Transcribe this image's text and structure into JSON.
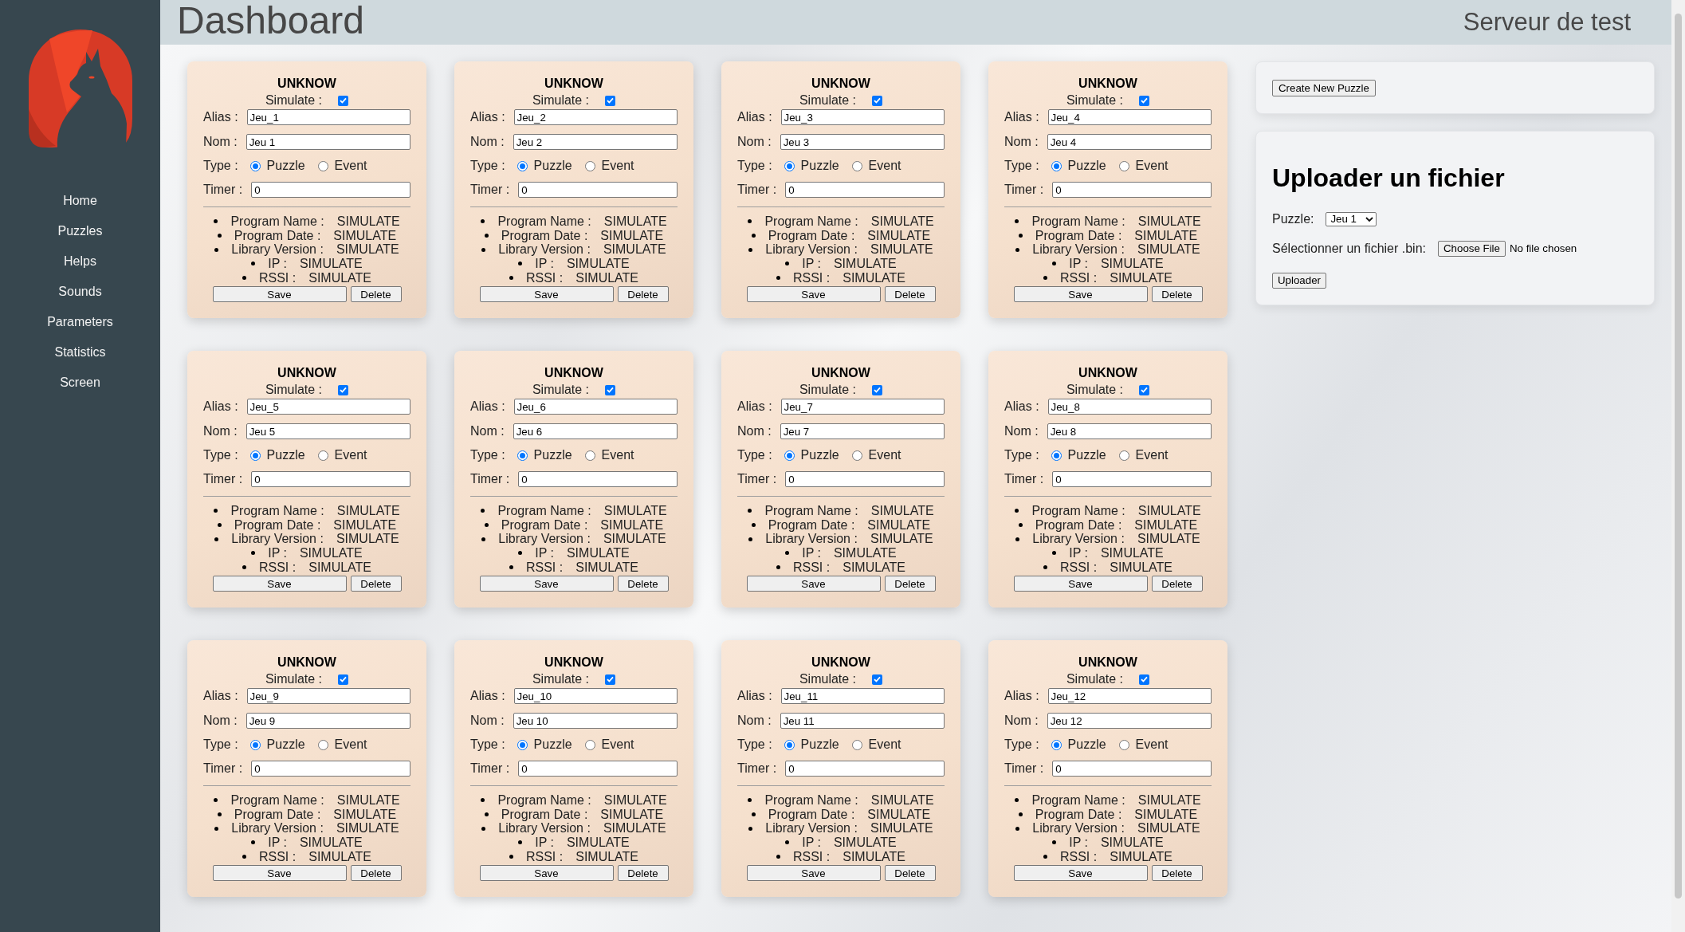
{
  "sidebar": {
    "items": [
      "Home",
      "Puzzles",
      "Helps",
      "Sounds",
      "Parameters",
      "Statistics",
      "Screen"
    ]
  },
  "header": {
    "title": "Dashboard",
    "server": "Serveur de test"
  },
  "puzzles": [
    {
      "title": "UNKNOW",
      "simulate": {
        "label": "Simulate :",
        "checked": true
      },
      "alias": {
        "label": "Alias :",
        "value": "Jeu_1"
      },
      "nom": {
        "label": "Nom :",
        "value": "Jeu 1"
      },
      "type": {
        "label": "Type :",
        "options": [
          {
            "label": "Puzzle",
            "selected": true
          },
          {
            "label": "Event",
            "selected": false
          }
        ]
      },
      "timer": {
        "label": "Timer :",
        "value": "0"
      },
      "info": [
        {
          "label": "Program Name :",
          "value": "SIMULATE"
        },
        {
          "label": "Program Date :",
          "value": "SIMULATE"
        },
        {
          "label": "Library Version :",
          "value": "SIMULATE"
        },
        {
          "label": "IP :",
          "value": "SIMULATE"
        },
        {
          "label": "RSSI :",
          "value": "SIMULATE"
        }
      ],
      "buttons": [
        {
          "kind": "save",
          "label": "Save"
        },
        {
          "kind": "delete",
          "label": "Delete"
        }
      ]
    },
    {
      "title": "UNKNOW",
      "simulate": {
        "label": "Simulate :",
        "checked": true
      },
      "alias": {
        "label": "Alias :",
        "value": "Jeu_2"
      },
      "nom": {
        "label": "Nom :",
        "value": "Jeu 2"
      },
      "type": {
        "label": "Type :",
        "options": [
          {
            "label": "Puzzle",
            "selected": true
          },
          {
            "label": "Event",
            "selected": false
          }
        ]
      },
      "timer": {
        "label": "Timer :",
        "value": "0"
      },
      "info": [
        {
          "label": "Program Name :",
          "value": "SIMULATE"
        },
        {
          "label": "Program Date :",
          "value": "SIMULATE"
        },
        {
          "label": "Library Version :",
          "value": "SIMULATE"
        },
        {
          "label": "IP :",
          "value": "SIMULATE"
        },
        {
          "label": "RSSI :",
          "value": "SIMULATE"
        }
      ],
      "buttons": [
        {
          "kind": "save",
          "label": "Save"
        },
        {
          "kind": "delete",
          "label": "Delete"
        }
      ]
    },
    {
      "title": "UNKNOW",
      "simulate": {
        "label": "Simulate :",
        "checked": true
      },
      "alias": {
        "label": "Alias :",
        "value": "Jeu_3"
      },
      "nom": {
        "label": "Nom :",
        "value": "Jeu 3"
      },
      "type": {
        "label": "Type :",
        "options": [
          {
            "label": "Puzzle",
            "selected": true
          },
          {
            "label": "Event",
            "selected": false
          }
        ]
      },
      "timer": {
        "label": "Timer :",
        "value": "0"
      },
      "info": [
        {
          "label": "Program Name :",
          "value": "SIMULATE"
        },
        {
          "label": "Program Date :",
          "value": "SIMULATE"
        },
        {
          "label": "Library Version :",
          "value": "SIMULATE"
        },
        {
          "label": "IP :",
          "value": "SIMULATE"
        },
        {
          "label": "RSSI :",
          "value": "SIMULATE"
        }
      ],
      "buttons": [
        {
          "kind": "save",
          "label": "Save"
        },
        {
          "kind": "delete",
          "label": "Delete"
        }
      ]
    },
    {
      "title": "UNKNOW",
      "simulate": {
        "label": "Simulate :",
        "checked": true
      },
      "alias": {
        "label": "Alias :",
        "value": "Jeu_4"
      },
      "nom": {
        "label": "Nom :",
        "value": "Jeu 4"
      },
      "type": {
        "label": "Type :",
        "options": [
          {
            "label": "Puzzle",
            "selected": true
          },
          {
            "label": "Event",
            "selected": false
          }
        ]
      },
      "timer": {
        "label": "Timer :",
        "value": "0"
      },
      "info": [
        {
          "label": "Program Name :",
          "value": "SIMULATE"
        },
        {
          "label": "Program Date :",
          "value": "SIMULATE"
        },
        {
          "label": "Library Version :",
          "value": "SIMULATE"
        },
        {
          "label": "IP :",
          "value": "SIMULATE"
        },
        {
          "label": "RSSI :",
          "value": "SIMULATE"
        }
      ],
      "buttons": [
        {
          "kind": "save",
          "label": "Save"
        },
        {
          "kind": "delete",
          "label": "Delete"
        }
      ]
    },
    {
      "title": "UNKNOW",
      "simulate": {
        "label": "Simulate :",
        "checked": true
      },
      "alias": {
        "label": "Alias :",
        "value": "Jeu_5"
      },
      "nom": {
        "label": "Nom :",
        "value": "Jeu 5"
      },
      "type": {
        "label": "Type :",
        "options": [
          {
            "label": "Puzzle",
            "selected": true
          },
          {
            "label": "Event",
            "selected": false
          }
        ]
      },
      "timer": {
        "label": "Timer :",
        "value": "0"
      },
      "info": [
        {
          "label": "Program Name :",
          "value": "SIMULATE"
        },
        {
          "label": "Program Date :",
          "value": "SIMULATE"
        },
        {
          "label": "Library Version :",
          "value": "SIMULATE"
        },
        {
          "label": "IP :",
          "value": "SIMULATE"
        },
        {
          "label": "RSSI :",
          "value": "SIMULATE"
        }
      ],
      "buttons": [
        {
          "kind": "save",
          "label": "Save"
        },
        {
          "kind": "delete",
          "label": "Delete"
        }
      ]
    },
    {
      "title": "UNKNOW",
      "simulate": {
        "label": "Simulate :",
        "checked": true
      },
      "alias": {
        "label": "Alias :",
        "value": "Jeu_6"
      },
      "nom": {
        "label": "Nom :",
        "value": "Jeu 6"
      },
      "type": {
        "label": "Type :",
        "options": [
          {
            "label": "Puzzle",
            "selected": true
          },
          {
            "label": "Event",
            "selected": false
          }
        ]
      },
      "timer": {
        "label": "Timer :",
        "value": "0"
      },
      "info": [
        {
          "label": "Program Name :",
          "value": "SIMULATE"
        },
        {
          "label": "Program Date :",
          "value": "SIMULATE"
        },
        {
          "label": "Library Version :",
          "value": "SIMULATE"
        },
        {
          "label": "IP :",
          "value": "SIMULATE"
        },
        {
          "label": "RSSI :",
          "value": "SIMULATE"
        }
      ],
      "buttons": [
        {
          "kind": "save",
          "label": "Save"
        },
        {
          "kind": "delete",
          "label": "Delete"
        }
      ]
    },
    {
      "title": "UNKNOW",
      "simulate": {
        "label": "Simulate :",
        "checked": true
      },
      "alias": {
        "label": "Alias :",
        "value": "Jeu_7"
      },
      "nom": {
        "label": "Nom :",
        "value": "Jeu 7"
      },
      "type": {
        "label": "Type :",
        "options": [
          {
            "label": "Puzzle",
            "selected": true
          },
          {
            "label": "Event",
            "selected": false
          }
        ]
      },
      "timer": {
        "label": "Timer :",
        "value": "0"
      },
      "info": [
        {
          "label": "Program Name :",
          "value": "SIMULATE"
        },
        {
          "label": "Program Date :",
          "value": "SIMULATE"
        },
        {
          "label": "Library Version :",
          "value": "SIMULATE"
        },
        {
          "label": "IP :",
          "value": "SIMULATE"
        },
        {
          "label": "RSSI :",
          "value": "SIMULATE"
        }
      ],
      "buttons": [
        {
          "kind": "save",
          "label": "Save"
        },
        {
          "kind": "delete",
          "label": "Delete"
        }
      ]
    },
    {
      "title": "UNKNOW",
      "simulate": {
        "label": "Simulate :",
        "checked": true
      },
      "alias": {
        "label": "Alias :",
        "value": "Jeu_8"
      },
      "nom": {
        "label": "Nom :",
        "value": "Jeu 8"
      },
      "type": {
        "label": "Type :",
        "options": [
          {
            "label": "Puzzle",
            "selected": true
          },
          {
            "label": "Event",
            "selected": false
          }
        ]
      },
      "timer": {
        "label": "Timer :",
        "value": "0"
      },
      "info": [
        {
          "label": "Program Name :",
          "value": "SIMULATE"
        },
        {
          "label": "Program Date :",
          "value": "SIMULATE"
        },
        {
          "label": "Library Version :",
          "value": "SIMULATE"
        },
        {
          "label": "IP :",
          "value": "SIMULATE"
        },
        {
          "label": "RSSI :",
          "value": "SIMULATE"
        }
      ],
      "buttons": [
        {
          "kind": "save",
          "label": "Save"
        },
        {
          "kind": "delete",
          "label": "Delete"
        }
      ]
    },
    {
      "title": "UNKNOW",
      "simulate": {
        "label": "Simulate :",
        "checked": true
      },
      "alias": {
        "label": "Alias :",
        "value": "Jeu_9"
      },
      "nom": {
        "label": "Nom :",
        "value": "Jeu 9"
      },
      "type": {
        "label": "Type :",
        "options": [
          {
            "label": "Puzzle",
            "selected": true
          },
          {
            "label": "Event",
            "selected": false
          }
        ]
      },
      "timer": {
        "label": "Timer :",
        "value": "0"
      },
      "info": [
        {
          "label": "Program Name :",
          "value": "SIMULATE"
        },
        {
          "label": "Program Date :",
          "value": "SIMULATE"
        },
        {
          "label": "Library Version :",
          "value": "SIMULATE"
        },
        {
          "label": "IP :",
          "value": "SIMULATE"
        },
        {
          "label": "RSSI :",
          "value": "SIMULATE"
        }
      ],
      "buttons": [
        {
          "kind": "save",
          "label": "Save"
        },
        {
          "kind": "delete",
          "label": "Delete"
        }
      ]
    },
    {
      "title": "UNKNOW",
      "simulate": {
        "label": "Simulate :",
        "checked": true
      },
      "alias": {
        "label": "Alias :",
        "value": "Jeu_10"
      },
      "nom": {
        "label": "Nom :",
        "value": "Jeu 10"
      },
      "type": {
        "label": "Type :",
        "options": [
          {
            "label": "Puzzle",
            "selected": true
          },
          {
            "label": "Event",
            "selected": false
          }
        ]
      },
      "timer": {
        "label": "Timer :",
        "value": "0"
      },
      "info": [
        {
          "label": "Program Name :",
          "value": "SIMULATE"
        },
        {
          "label": "Program Date :",
          "value": "SIMULATE"
        },
        {
          "label": "Library Version :",
          "value": "SIMULATE"
        },
        {
          "label": "IP :",
          "value": "SIMULATE"
        },
        {
          "label": "RSSI :",
          "value": "SIMULATE"
        }
      ],
      "buttons": [
        {
          "kind": "save",
          "label": "Save"
        },
        {
          "kind": "delete",
          "label": "Delete"
        }
      ]
    },
    {
      "title": "UNKNOW",
      "simulate": {
        "label": "Simulate :",
        "checked": true
      },
      "alias": {
        "label": "Alias :",
        "value": "Jeu_11"
      },
      "nom": {
        "label": "Nom :",
        "value": "Jeu 11"
      },
      "type": {
        "label": "Type :",
        "options": [
          {
            "label": "Puzzle",
            "selected": true
          },
          {
            "label": "Event",
            "selected": false
          }
        ]
      },
      "timer": {
        "label": "Timer :",
        "value": "0"
      },
      "info": [
        {
          "label": "Program Name :",
          "value": "SIMULATE"
        },
        {
          "label": "Program Date :",
          "value": "SIMULATE"
        },
        {
          "label": "Library Version :",
          "value": "SIMULATE"
        },
        {
          "label": "IP :",
          "value": "SIMULATE"
        },
        {
          "label": "RSSI :",
          "value": "SIMULATE"
        }
      ],
      "buttons": [
        {
          "kind": "save",
          "label": "Save"
        },
        {
          "kind": "delete",
          "label": "Delete"
        }
      ]
    },
    {
      "title": "UNKNOW",
      "simulate": {
        "label": "Simulate :",
        "checked": true
      },
      "alias": {
        "label": "Alias :",
        "value": "Jeu_12"
      },
      "nom": {
        "label": "Nom :",
        "value": "Jeu 12"
      },
      "type": {
        "label": "Type :",
        "options": [
          {
            "label": "Puzzle",
            "selected": true
          },
          {
            "label": "Event",
            "selected": false
          }
        ]
      },
      "timer": {
        "label": "Timer :",
        "value": "0"
      },
      "info": [
        {
          "label": "Program Name :",
          "value": "SIMULATE"
        },
        {
          "label": "Program Date :",
          "value": "SIMULATE"
        },
        {
          "label": "Library Version :",
          "value": "SIMULATE"
        },
        {
          "label": "IP :",
          "value": "SIMULATE"
        },
        {
          "label": "RSSI :",
          "value": "SIMULATE"
        }
      ],
      "buttons": [
        {
          "kind": "save",
          "label": "Save"
        },
        {
          "kind": "delete",
          "label": "Delete"
        }
      ]
    }
  ],
  "create_panel": {
    "button": "Create New Puzzle"
  },
  "upload_panel": {
    "title": "Uploader un fichier",
    "puzzle": {
      "label": "Puzzle:",
      "value": "Jeu 1"
    },
    "file": {
      "label": "Sélectionner un fichier .bin:",
      "button": "Choose File",
      "status": "No file chosen"
    },
    "submit": "Uploader"
  }
}
